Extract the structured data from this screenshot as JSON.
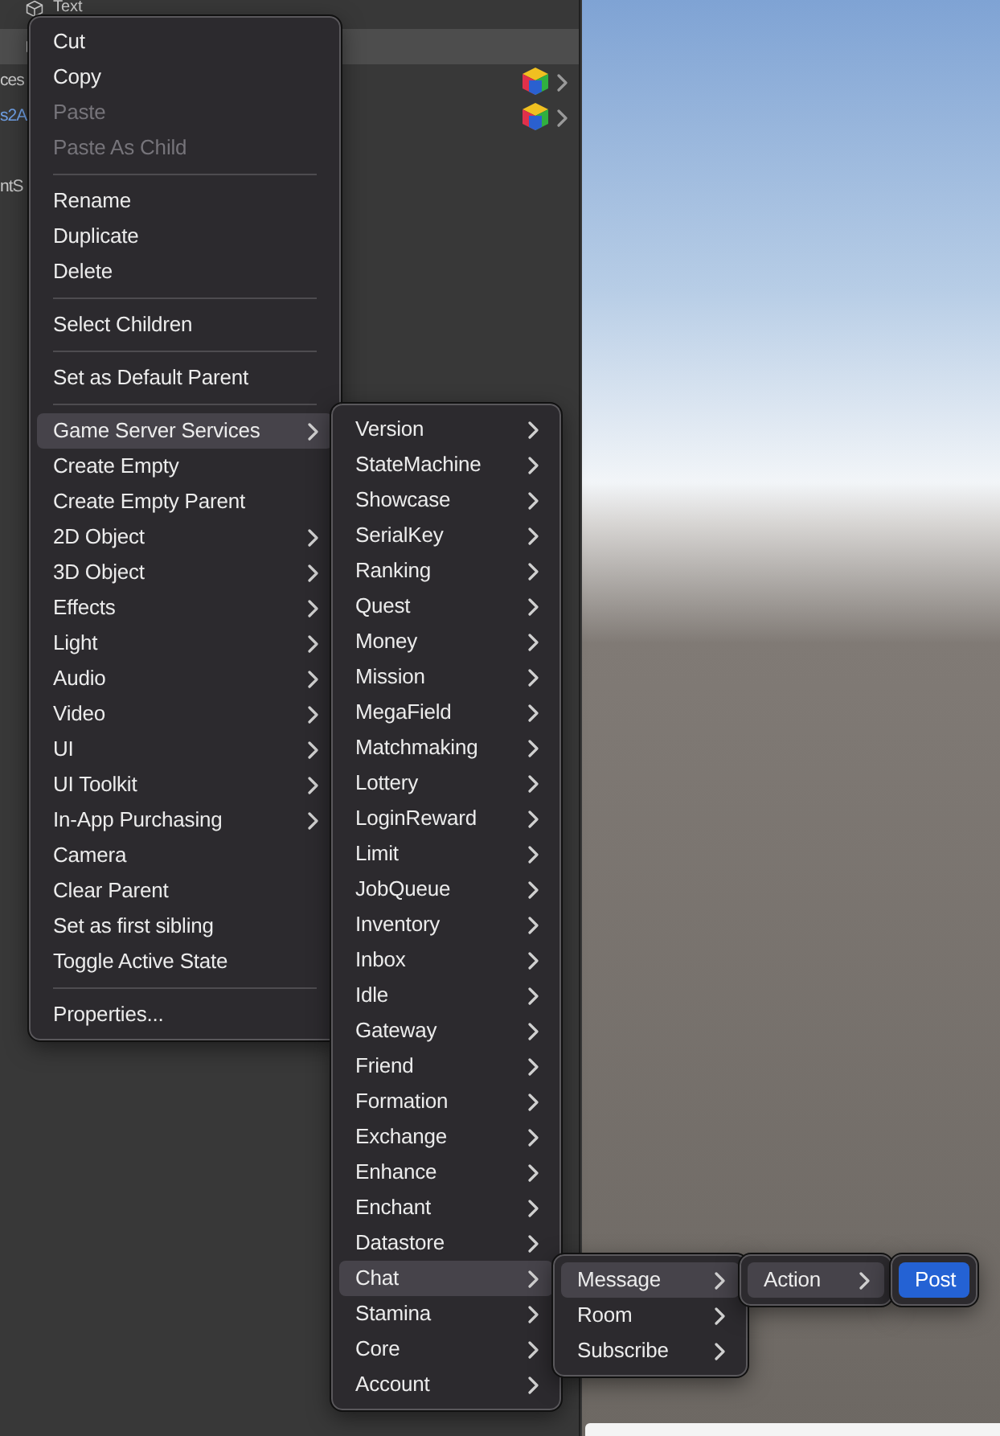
{
  "hierarchy": {
    "rows": [
      {
        "kind": "object",
        "label": "Text",
        "selected": false
      },
      {
        "kind": "object",
        "selected": true
      },
      {
        "kind": "variant",
        "label": "ces",
        "selected": false
      },
      {
        "kind": "prefab",
        "label": "s2A",
        "selected": false
      },
      {
        "kind": "plain",
        "label": "ntS",
        "selected": false
      }
    ]
  },
  "menus": [
    {
      "focused": false,
      "items": [
        {
          "kind": "item",
          "label": "Cut",
          "disabled": false,
          "submenu": false,
          "selected": false
        },
        {
          "kind": "item",
          "label": "Copy",
          "disabled": false,
          "submenu": false,
          "selected": false
        },
        {
          "kind": "item",
          "label": "Paste",
          "disabled": true,
          "submenu": false,
          "selected": false
        },
        {
          "kind": "item",
          "label": "Paste As Child",
          "disabled": true,
          "submenu": false,
          "selected": false
        },
        {
          "kind": "separator"
        },
        {
          "kind": "item",
          "label": "Rename",
          "disabled": false,
          "submenu": false,
          "selected": false
        },
        {
          "kind": "item",
          "label": "Duplicate",
          "disabled": false,
          "submenu": false,
          "selected": false
        },
        {
          "kind": "item",
          "label": "Delete",
          "disabled": false,
          "submenu": false,
          "selected": false
        },
        {
          "kind": "separator"
        },
        {
          "kind": "item",
          "label": "Select Children",
          "disabled": false,
          "submenu": false,
          "selected": false
        },
        {
          "kind": "separator"
        },
        {
          "kind": "item",
          "label": "Set as Default Parent",
          "disabled": false,
          "submenu": false,
          "selected": false
        },
        {
          "kind": "separator"
        },
        {
          "kind": "item",
          "label": "Game Server Services",
          "disabled": false,
          "submenu": true,
          "selected": true
        },
        {
          "kind": "item",
          "label": "Create Empty",
          "disabled": false,
          "submenu": false,
          "selected": false
        },
        {
          "kind": "item",
          "label": "Create Empty Parent",
          "disabled": false,
          "submenu": false,
          "selected": false
        },
        {
          "kind": "item",
          "label": "2D Object",
          "disabled": false,
          "submenu": true,
          "selected": false
        },
        {
          "kind": "item",
          "label": "3D Object",
          "disabled": false,
          "submenu": true,
          "selected": false
        },
        {
          "kind": "item",
          "label": "Effects",
          "disabled": false,
          "submenu": true,
          "selected": false
        },
        {
          "kind": "item",
          "label": "Light",
          "disabled": false,
          "submenu": true,
          "selected": false
        },
        {
          "kind": "item",
          "label": "Audio",
          "disabled": false,
          "submenu": true,
          "selected": false
        },
        {
          "kind": "item",
          "label": "Video",
          "disabled": false,
          "submenu": true,
          "selected": false
        },
        {
          "kind": "item",
          "label": "UI",
          "disabled": false,
          "submenu": true,
          "selected": false
        },
        {
          "kind": "item",
          "label": "UI Toolkit",
          "disabled": false,
          "submenu": true,
          "selected": false
        },
        {
          "kind": "item",
          "label": "In-App Purchasing",
          "disabled": false,
          "submenu": true,
          "selected": false
        },
        {
          "kind": "item",
          "label": "Camera",
          "disabled": false,
          "submenu": false,
          "selected": false
        },
        {
          "kind": "item",
          "label": "Clear Parent",
          "disabled": false,
          "submenu": false,
          "selected": false
        },
        {
          "kind": "item",
          "label": "Set as first sibling",
          "disabled": false,
          "submenu": false,
          "selected": false
        },
        {
          "kind": "item",
          "label": "Toggle Active State",
          "disabled": false,
          "submenu": false,
          "selected": false
        },
        {
          "kind": "separator"
        },
        {
          "kind": "item",
          "label": "Properties...",
          "disabled": false,
          "submenu": false,
          "selected": false
        }
      ]
    },
    {
      "focused": false,
      "items": [
        {
          "kind": "item",
          "label": "Version",
          "disabled": false,
          "submenu": true,
          "selected": false
        },
        {
          "kind": "item",
          "label": "StateMachine",
          "disabled": false,
          "submenu": true,
          "selected": false
        },
        {
          "kind": "item",
          "label": "Showcase",
          "disabled": false,
          "submenu": true,
          "selected": false
        },
        {
          "kind": "item",
          "label": "SerialKey",
          "disabled": false,
          "submenu": true,
          "selected": false
        },
        {
          "kind": "item",
          "label": "Ranking",
          "disabled": false,
          "submenu": true,
          "selected": false
        },
        {
          "kind": "item",
          "label": "Quest",
          "disabled": false,
          "submenu": true,
          "selected": false
        },
        {
          "kind": "item",
          "label": "Money",
          "disabled": false,
          "submenu": true,
          "selected": false
        },
        {
          "kind": "item",
          "label": "Mission",
          "disabled": false,
          "submenu": true,
          "selected": false
        },
        {
          "kind": "item",
          "label": "MegaField",
          "disabled": false,
          "submenu": true,
          "selected": false
        },
        {
          "kind": "item",
          "label": "Matchmaking",
          "disabled": false,
          "submenu": true,
          "selected": false
        },
        {
          "kind": "item",
          "label": "Lottery",
          "disabled": false,
          "submenu": true,
          "selected": false
        },
        {
          "kind": "item",
          "label": "LoginReward",
          "disabled": false,
          "submenu": true,
          "selected": false
        },
        {
          "kind": "item",
          "label": "Limit",
          "disabled": false,
          "submenu": true,
          "selected": false
        },
        {
          "kind": "item",
          "label": "JobQueue",
          "disabled": false,
          "submenu": true,
          "selected": false
        },
        {
          "kind": "item",
          "label": "Inventory",
          "disabled": false,
          "submenu": true,
          "selected": false
        },
        {
          "kind": "item",
          "label": "Inbox",
          "disabled": false,
          "submenu": true,
          "selected": false
        },
        {
          "kind": "item",
          "label": "Idle",
          "disabled": false,
          "submenu": true,
          "selected": false
        },
        {
          "kind": "item",
          "label": "Gateway",
          "disabled": false,
          "submenu": true,
          "selected": false
        },
        {
          "kind": "item",
          "label": "Friend",
          "disabled": false,
          "submenu": true,
          "selected": false
        },
        {
          "kind": "item",
          "label": "Formation",
          "disabled": false,
          "submenu": true,
          "selected": false
        },
        {
          "kind": "item",
          "label": "Exchange",
          "disabled": false,
          "submenu": true,
          "selected": false
        },
        {
          "kind": "item",
          "label": "Enhance",
          "disabled": false,
          "submenu": true,
          "selected": false
        },
        {
          "kind": "item",
          "label": "Enchant",
          "disabled": false,
          "submenu": true,
          "selected": false
        },
        {
          "kind": "item",
          "label": "Datastore",
          "disabled": false,
          "submenu": true,
          "selected": false
        },
        {
          "kind": "item",
          "label": "Chat",
          "disabled": false,
          "submenu": true,
          "selected": true
        },
        {
          "kind": "item",
          "label": "Stamina",
          "disabled": false,
          "submenu": true,
          "selected": false
        },
        {
          "kind": "item",
          "label": "Core",
          "disabled": false,
          "submenu": true,
          "selected": false
        },
        {
          "kind": "item",
          "label": "Account",
          "disabled": false,
          "submenu": true,
          "selected": false
        }
      ]
    },
    {
      "focused": false,
      "items": [
        {
          "kind": "item",
          "label": "Message",
          "disabled": false,
          "submenu": true,
          "selected": true
        },
        {
          "kind": "item",
          "label": "Room",
          "disabled": false,
          "submenu": true,
          "selected": false
        },
        {
          "kind": "item",
          "label": "Subscribe",
          "disabled": false,
          "submenu": true,
          "selected": false
        }
      ]
    },
    {
      "focused": false,
      "items": [
        {
          "kind": "item",
          "label": "Action",
          "disabled": false,
          "submenu": true,
          "selected": true
        }
      ]
    },
    {
      "focused": true,
      "items": [
        {
          "kind": "item",
          "label": "Post",
          "disabled": false,
          "submenu": false,
          "selected": true
        }
      ]
    }
  ]
}
